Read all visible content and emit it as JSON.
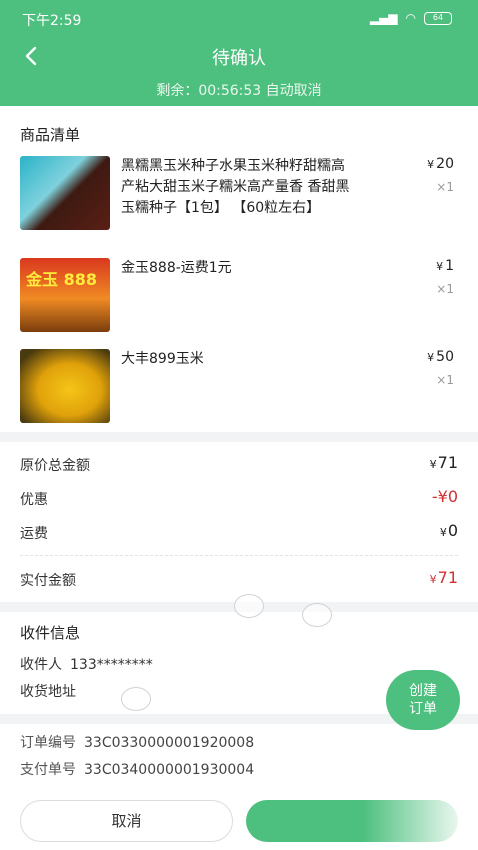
{
  "status_bar": {
    "time": "下午2:59",
    "signal": "HD",
    "battery": "64"
  },
  "header": {
    "back_icon": "chevron-left-icon",
    "title": "待确认",
    "countdown": "剩余：00:56:53 自动取消"
  },
  "goods": {
    "section_title": "商品清单",
    "items": [
      {
        "name": "黑糯黑玉米种子水果玉米种籽甜糯高产粘大甜玉米子糯米高产量香 香甜黑玉糯种子【1包】 【60粒左右】",
        "currency": "¥",
        "price": "20",
        "qty": "×1"
      },
      {
        "name": "金玉888-运费1元",
        "currency": "¥",
        "price": "1",
        "qty": "×1",
        "image_text": "金玉 888"
      },
      {
        "name": "大丰899玉米",
        "currency": "¥",
        "price": "50",
        "qty": "×1"
      }
    ]
  },
  "amounts": {
    "original_label": "原价总金额",
    "original_currency": "¥",
    "original_value": "71",
    "discount_label": "优惠",
    "discount_value": "-¥0",
    "shipping_label": "运费",
    "shipping_currency": "¥",
    "shipping_value": "0",
    "paid_label": "实付金额",
    "paid_currency": "¥",
    "paid_value": "71"
  },
  "receiver": {
    "section_title": "收件信息",
    "name_label": "收件人",
    "name_value": "133********",
    "address_label": "收货地址"
  },
  "fab": {
    "line1": "创建",
    "line2": "订单"
  },
  "order": {
    "order_no_label": "订单编号",
    "order_no": "33C0330000001920008",
    "pay_no_label": "支付单号",
    "pay_no": "33C0340000001930004"
  },
  "bottom": {
    "cancel_label": "取消"
  },
  "colors": {
    "primary": "#4dbf7e",
    "price_red": "#d32f2f"
  }
}
